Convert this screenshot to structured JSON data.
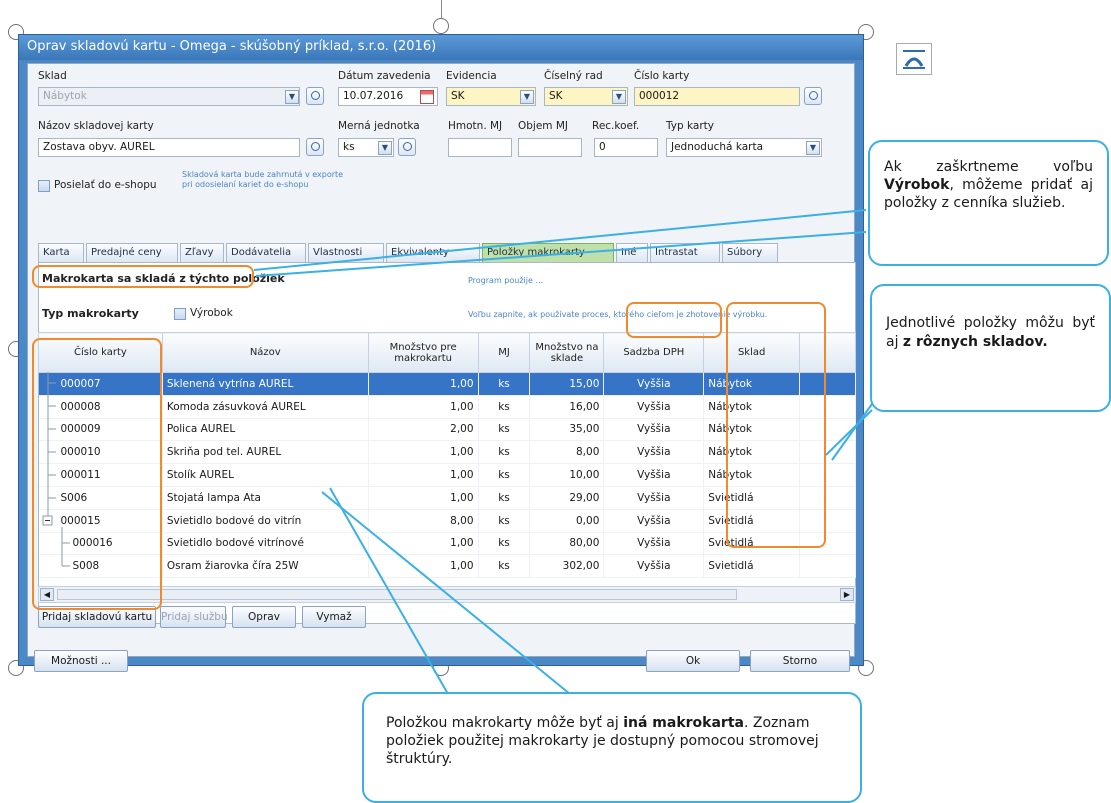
{
  "window": {
    "title": "Oprav skladovú kartu - Omega - skúšobný príklad, s.r.o. (2016)"
  },
  "form": {
    "sklad_label": "Sklad",
    "sklad_value": "Nábytok",
    "datum_label": "Dátum zavedenia",
    "datum_value": "10.07.2016",
    "evidencia_label": "Evidencia",
    "evidencia_value": "SK",
    "ciselny_rad_label": "Číselný rad",
    "ciselny_rad_value": "SK",
    "cislo_karty_label": "Číslo karty",
    "cislo_karty_value": "000012",
    "nazov_label": "Názov skladovej karty",
    "nazov_value": "Zostava obyv. AUREL",
    "merna_label": "Merná jednotka",
    "merna_value": "ks",
    "hmotn_label": "Hmotn. MJ",
    "objem_label": "Objem MJ",
    "reckoef_label": "Rec.koef.",
    "reckoef_value": "0",
    "typ_karty_label": "Typ karty",
    "typ_karty_value": "Jednoduchá karta",
    "eshop_label": "Posielať do e-shopu",
    "eshop_note_1": "Skladová karta bude zahrnutá v exporte",
    "eshop_note_2": "pri odosielaní kariet do e-shopu"
  },
  "tabs": [
    "Karta",
    "Predajné ceny",
    "Zľavy",
    "Dodávatelia",
    "Vlastnosti",
    "Ekvivalenty",
    "Položky makrokarty",
    "Iné",
    "Intrastat",
    "Súbory"
  ],
  "panel": {
    "heading": "Makrokarta sa skladá z týchto položiek",
    "note_right": "Program použije ...",
    "typ_label": "Typ makrokarty",
    "vyrobok_label": "Výrobok",
    "vyrobok_note": "Voľbu zapnite, ak používate proces, ktorého cieľom je zhotovenie výrobku."
  },
  "grid": {
    "columns": [
      "Číslo karty",
      "Názov",
      "Množstvo pre makrokartu",
      "MJ",
      "Množstvo na sklade",
      "Sadzba DPH",
      "Sklad"
    ],
    "rows": [
      [
        "000007",
        "Sklenená vytrína AUREL",
        "1,00",
        "ks",
        "15,00",
        "Vyššia",
        "Nábytok"
      ],
      [
        "000008",
        "Komoda zásuvková AUREL",
        "1,00",
        "ks",
        "16,00",
        "Vyššia",
        "Nábytok"
      ],
      [
        "000009",
        "Polica AUREL",
        "2,00",
        "ks",
        "35,00",
        "Vyššia",
        "Nábytok"
      ],
      [
        "000010",
        "Skriňa pod tel. AUREL",
        "1,00",
        "ks",
        "8,00",
        "Vyššia",
        "Nábytok"
      ],
      [
        "000011",
        "Stolík AUREL",
        "1,00",
        "ks",
        "10,00",
        "Vyššia",
        "Nábytok"
      ],
      [
        "S006",
        "Stojatá lampa Ata",
        "1,00",
        "ks",
        "29,00",
        "Vyššia",
        "Svietidlá"
      ],
      [
        "000015",
        "Svietidlo bodové do vitrín",
        "8,00",
        "ks",
        "0,00",
        "Vyššia",
        "Svietidlá"
      ],
      [
        "000016",
        "Svietidlo bodové vitrínové",
        "1,00",
        "ks",
        "80,00",
        "Vyššia",
        "Svietidlá"
      ],
      [
        "S008",
        "Osram žiarovka číra 25W",
        "1,00",
        "ks",
        "302,00",
        "Vyššia",
        "Svietidlá"
      ]
    ]
  },
  "buttons": {
    "pridaj_skladovu": "Pridaj skladovú kartu",
    "pridaj_sluzbu": "Pridaj službu",
    "oprav": "Oprav",
    "vymaz": "Vymaž",
    "moznosti": "Možnosti ...",
    "ok": "Ok",
    "storno": "Storno"
  },
  "callouts": {
    "c1_pre": "Ak zaškrtneme voľbu ",
    "c1_bold": "Výrobok",
    "c1_post": ", môžeme pridať aj položky z cenníka služieb.",
    "c2_pre": "Jednotlivé položky môžu byť aj ",
    "c2_bold": "z rôznych skladov.",
    "c3_pre": "Položkou makrokarty môže byť aj ",
    "c3_bold": "iná makrokarta",
    "c3_post": ". Zoznam položiek použitej makrokarty je dostupný pomocou stromovej štruktúry."
  },
  "colors": {
    "accent": "#3ab0e6",
    "highlight": "#f08a2c",
    "title_bar": "#4a88c8",
    "selection": "#3574c6",
    "active_tab": "#bfe0a8"
  }
}
